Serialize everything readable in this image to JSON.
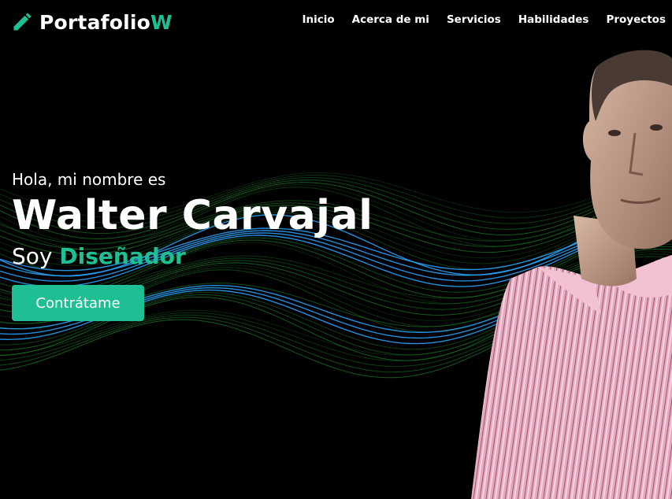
{
  "brand": {
    "icon": "pencil-icon",
    "name_main": "Portafolio",
    "name_accent": "W"
  },
  "nav": {
    "items": [
      {
        "label": "Inicio"
      },
      {
        "label": "Acerca de mi"
      },
      {
        "label": "Servicios"
      },
      {
        "label": "Habilidades"
      },
      {
        "label": "Proyectos"
      }
    ]
  },
  "hero": {
    "greeting": "Hola, mi nombre es",
    "name": "Walter Carvajal",
    "role_prefix": "Soy",
    "role_word": "Diseñador",
    "cta_label": "Contrátame"
  },
  "colors": {
    "accent": "#1fbf95",
    "background": "#000000",
    "wave_green": "#1e8c2a",
    "wave_blue": "#2aa7ff"
  }
}
